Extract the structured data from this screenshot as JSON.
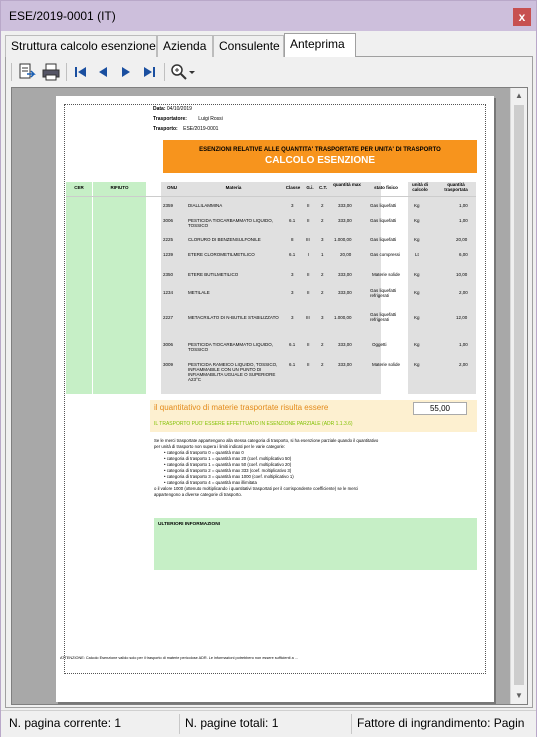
{
  "window": {
    "title": "ESE/2019-0001 (IT)",
    "close_label": "x"
  },
  "tabs": [
    {
      "label": "Struttura calcolo esenzione"
    },
    {
      "label": "Azienda"
    },
    {
      "label": "Consulente"
    },
    {
      "label": "Anteprima"
    }
  ],
  "toolbar": {
    "icons": [
      "export-icon",
      "print-icon",
      "first-page-icon",
      "prev-page-icon",
      "next-page-icon",
      "last-page-icon",
      "zoom-icon",
      "dropdown-arrow-icon"
    ]
  },
  "report": {
    "meta": {
      "date_label": "Data:",
      "date_value": "04/10/2019",
      "carrier_label": "Trasportatore:",
      "carrier_value": "Luigi Rossi",
      "transport_label": "Trasporto:",
      "transport_value": "ESE/2019-0001"
    },
    "header_line1": "ESENZIONI RELATIVE ALLE QUANTITA' TRASPORTATE PER UNITA' DI TRASPORTO",
    "header_line2": "CALCOLO ESENZIONE",
    "columns": {
      "cer": "CER",
      "rifiuto": "RIFIUTO",
      "onu": "ONU",
      "materia": "Materia",
      "classe": "Classe",
      "gi": "G.i.",
      "ct": "C.T.",
      "qmax": "quantità max",
      "stato": "stato fisico",
      "unita": "unità di calcolo",
      "qtrasp": "quantità trasportata"
    },
    "rows": [
      {
        "onu": "2359",
        "materia": "DIALLILAMMINA",
        "classe": "3",
        "gi": "II",
        "ct": "2",
        "qmax": "333,00",
        "stato": "Gas liquefatti",
        "unita": "Kg",
        "q": "1,00"
      },
      {
        "onu": "3006",
        "materia": "PESTICIDA TIOCARBAMMATO LIQUIDO, TOSSICO",
        "classe": "6.1",
        "gi": "II",
        "ct": "2",
        "qmax": "333,00",
        "stato": "Gas liquefatti",
        "unita": "Kg",
        "q": "1,00"
      },
      {
        "onu": "2225",
        "materia": "CLORURO DI BENZENSULFONILE",
        "classe": "8",
        "gi": "III",
        "ct": "3",
        "qmax": "1.000,00",
        "stato": "Gas liquefatti",
        "unita": "Kg",
        "q": "20,00"
      },
      {
        "onu": "1239",
        "materia": "ETERE CLOROMETILMETILICO",
        "classe": "6.1",
        "gi": "I",
        "ct": "1",
        "qmax": "20,00",
        "stato": "Gas compressi",
        "unita": "Lt",
        "q": "6,00"
      },
      {
        "onu": "2350",
        "materia": "ETERE BUTILMETILICO",
        "classe": "3",
        "gi": "II",
        "ct": "2",
        "qmax": "333,00",
        "stato": "Materie solide",
        "unita": "Kg",
        "q": "10,00"
      },
      {
        "onu": "1234",
        "materia": "METILALE",
        "classe": "3",
        "gi": "II",
        "ct": "2",
        "qmax": "333,00",
        "stato": "Gas liquefatti refrigerati",
        "unita": "Kg",
        "q": "2,00"
      },
      {
        "onu": "2227",
        "materia": "METACRILATO DI N-BUTILE STABILIZZATO",
        "classe": "3",
        "gi": "III",
        "ct": "3",
        "qmax": "1.000,00",
        "stato": "Gas liquefatti refrigerati",
        "unita": "Kg",
        "q": "12,00"
      },
      {
        "onu": "3006",
        "materia": "PESTICIDA TIOCARBAMMATO LIQUIDO, TOSSICO",
        "classe": "6.1",
        "gi": "II",
        "ct": "2",
        "qmax": "333,00",
        "stato": "Oggetti",
        "unita": "Kg",
        "q": "1,00"
      },
      {
        "onu": "3009",
        "materia": "PESTICIDA RAMEICO LIQUIDO, TOSSICO, INFIAMMABILE CON UN PUNTO DI INFIAMMABILITA UGUALE O SUPERIORE A23°C",
        "classe": "6.1",
        "gi": "II",
        "ct": "2",
        "qmax": "333,00",
        "stato": "Materie solide",
        "unita": "Kg",
        "q": "2,00"
      }
    ],
    "result_label": "il quantitativo di materie trasportate risulta essere",
    "result_value": "55,00",
    "result_note": "IL TRASPORTO PUO' ESSERE EFFETTUATO IN ESENZIONE PARZIALE (ADR 1.1.3.6)",
    "description": [
      "Se le merci trasportate appartengono alla stessa categoria di trasporto, si ha esenzione parziale quando il quantitativo",
      "per unità di trasporto non supera i limiti indicati per le varie categorie:",
      "  • categoria di trasporto 0 = quantità max 0",
      "  • categoria di trasporto 1 = quantità max 20 (coef. moltiplicativo 50)",
      "  • categoria di trasporto 1 = quantità max 50 (coef. moltiplicativo 20)",
      "  • categoria di trasporto 2 = quantità max 333 (coef. moltiplicativo 3)",
      "  • categoria di trasporto 3 = quantità max 1000 (coef. moltiplicativo 1)",
      "  • categoria di trasporto 4 = quantità max illimitata",
      "o il valore 1000 (ottenuto moltiplicando i quantitativi trasportati per il corrispondente coefficiente) se le merci",
      "appartengono a diverse categorie di trasporto."
    ],
    "info_title": "ULTERIORI INFORMAZIONI",
    "footer": "ATTENZIONE: Calcolo Esenzione valido solo per il trasporto di materie pericolose ADR. Le informazioni potrebbero non essere sufficienti a ..."
  },
  "status": {
    "current_page": "N. pagina corrente: 1",
    "total_pages": "N. pagine totali: 1",
    "zoom": "Fattore di ingrandimento: Pagin"
  },
  "colors": {
    "titlebar": "#cdbfdc",
    "orange": "#f7941d",
    "green": "#c6efc6",
    "result_bg": "#fdf0d0"
  }
}
